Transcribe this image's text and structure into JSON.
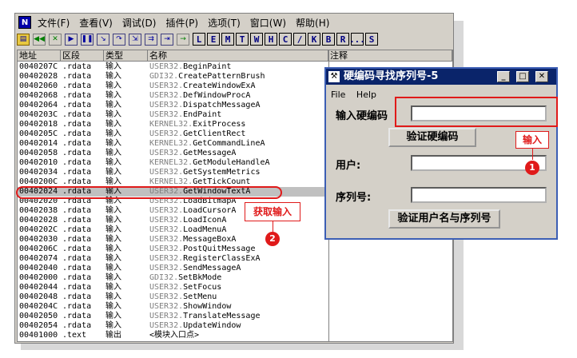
{
  "main_window": {
    "icon_letter": "N",
    "menu": [
      "文件(F)",
      "查看(V)",
      "调试(D)",
      "插件(P)",
      "选项(T)",
      "窗口(W)",
      "帮助(H)"
    ],
    "toolbar_letters": [
      "L",
      "E",
      "M",
      "T",
      "W",
      "H",
      "C",
      "/",
      "K",
      "B",
      "R",
      "...",
      "S"
    ],
    "columns": [
      "地址",
      "区段",
      "类型",
      "名称",
      "注释"
    ],
    "rows": [
      {
        "addr": "0040207C",
        "sec": ".rdata",
        "type": "输入",
        "lib": "USER32.",
        "fn": "BeginPaint"
      },
      {
        "addr": "00402028",
        "sec": ".rdata",
        "type": "输入",
        "lib": "GDI32.",
        "fn": "CreatePatternBrush"
      },
      {
        "addr": "00402060",
        "sec": ".rdata",
        "type": "输入",
        "lib": "USER32.",
        "fn": "CreateWindowExA"
      },
      {
        "addr": "00402068",
        "sec": ".rdata",
        "type": "输入",
        "lib": "USER32.",
        "fn": "DefWindowProcA"
      },
      {
        "addr": "00402064",
        "sec": ".rdata",
        "type": "输入",
        "lib": "USER32.",
        "fn": "DispatchMessageA"
      },
      {
        "addr": "0040203C",
        "sec": ".rdata",
        "type": "输入",
        "lib": "USER32.",
        "fn": "EndPaint"
      },
      {
        "addr": "00402018",
        "sec": ".rdata",
        "type": "输入",
        "lib": "KERNEL32.",
        "fn": "ExitProcess"
      },
      {
        "addr": "0040205C",
        "sec": ".rdata",
        "type": "输入",
        "lib": "USER32.",
        "fn": "GetClientRect"
      },
      {
        "addr": "00402014",
        "sec": ".rdata",
        "type": "输入",
        "lib": "KERNEL32.",
        "fn": "GetCommandLineA"
      },
      {
        "addr": "00402058",
        "sec": ".rdata",
        "type": "输入",
        "lib": "USER32.",
        "fn": "GetMessageA"
      },
      {
        "addr": "00402010",
        "sec": ".rdata",
        "type": "输入",
        "lib": "KERNEL32.",
        "fn": "GetModuleHandleA"
      },
      {
        "addr": "00402034",
        "sec": ".rdata",
        "type": "输入",
        "lib": "USER32.",
        "fn": "GetSystemMetrics"
      },
      {
        "addr": "0040200C",
        "sec": ".rdata",
        "type": "输入",
        "lib": "KERNEL32.",
        "fn": "GetTickCount"
      },
      {
        "addr": "00402024",
        "sec": ".rdata",
        "type": "输入",
        "lib": "USER32.",
        "fn": "GetWindowTextA"
      },
      {
        "addr": "00402020",
        "sec": ".rdata",
        "type": "输入",
        "lib": "USER32.",
        "fn": "LoadBitmapA"
      },
      {
        "addr": "00402038",
        "sec": ".rdata",
        "type": "输入",
        "lib": "USER32.",
        "fn": "LoadCursorA"
      },
      {
        "addr": "00402028",
        "sec": ".rdata",
        "type": "输入",
        "lib": "USER32.",
        "fn": "LoadIconA"
      },
      {
        "addr": "0040202C",
        "sec": ".rdata",
        "type": "输入",
        "lib": "USER32.",
        "fn": "LoadMenuA"
      },
      {
        "addr": "00402030",
        "sec": ".rdata",
        "type": "输入",
        "lib": "USER32.",
        "fn": "MessageBoxA"
      },
      {
        "addr": "0040206C",
        "sec": ".rdata",
        "type": "输入",
        "lib": "USER32.",
        "fn": "PostQuitMessage"
      },
      {
        "addr": "00402074",
        "sec": ".rdata",
        "type": "输入",
        "lib": "USER32.",
        "fn": "RegisterClassExA"
      },
      {
        "addr": "00402040",
        "sec": ".rdata",
        "type": "输入",
        "lib": "USER32.",
        "fn": "SendMessageA"
      },
      {
        "addr": "00402000",
        "sec": ".rdata",
        "type": "输入",
        "lib": "GDI32.",
        "fn": "SetBkMode"
      },
      {
        "addr": "00402044",
        "sec": ".rdata",
        "type": "输入",
        "lib": "USER32.",
        "fn": "SetFocus"
      },
      {
        "addr": "00402048",
        "sec": ".rdata",
        "type": "输入",
        "lib": "USER32.",
        "fn": "SetMenu"
      },
      {
        "addr": "0040204C",
        "sec": ".rdata",
        "type": "输入",
        "lib": "USER32.",
        "fn": "ShowWindow"
      },
      {
        "addr": "00402050",
        "sec": ".rdata",
        "type": "输入",
        "lib": "USER32.",
        "fn": "TranslateMessage"
      },
      {
        "addr": "00402054",
        "sec": ".rdata",
        "type": "输入",
        "lib": "USER32.",
        "fn": "UpdateWindow"
      },
      {
        "addr": "00401000",
        "sec": ".text",
        "type": "输出",
        "lib": "",
        "fn": "<模块入口点>"
      }
    ],
    "selected_row": 13
  },
  "dialog": {
    "title": "硬编码寻找序列号-5",
    "menu": [
      "File",
      "Help"
    ],
    "hardcode_label": "输入硬编码",
    "hardcode_value": "",
    "verify_hardcode_button": "验证硬编码",
    "user_label": "用户:",
    "user_value": "",
    "serial_label": "序列号:",
    "serial_value": "",
    "verify_user_button": "验证用户名与序列号"
  },
  "annotations": {
    "callout_1": "输入",
    "badge_1": "1",
    "callout_2": "获取输入",
    "badge_2": "2",
    "color": "#e01a1a"
  }
}
